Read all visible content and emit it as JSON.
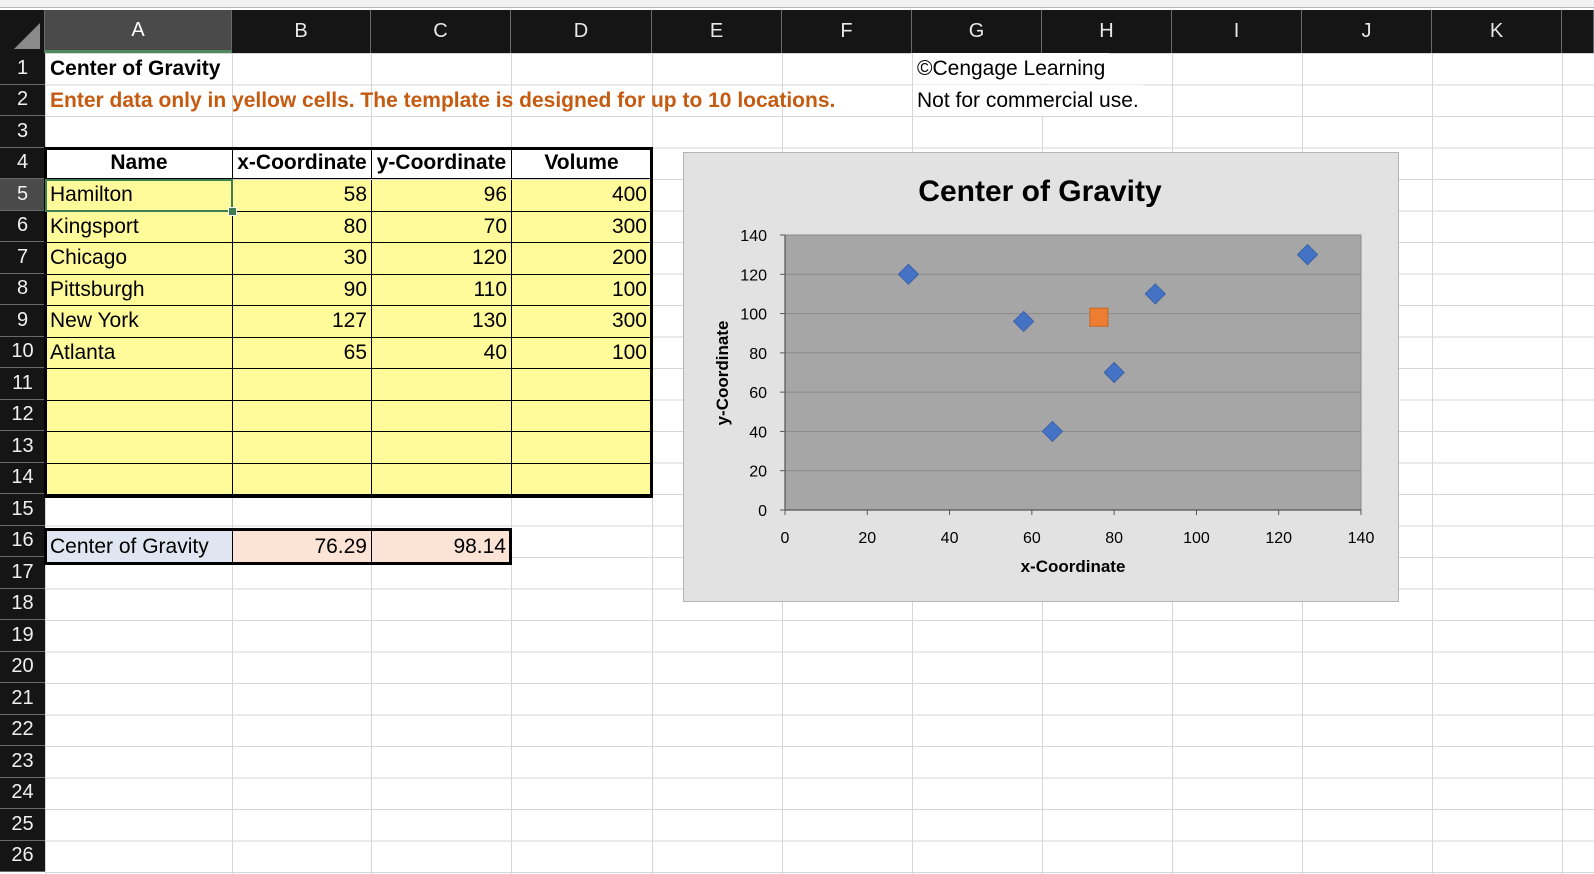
{
  "columns": [
    "A",
    "B",
    "C",
    "D",
    "E",
    "F",
    "G",
    "H",
    "I",
    "J",
    "K"
  ],
  "rows": [
    "1",
    "2",
    "3",
    "4",
    "5",
    "6",
    "7",
    "8",
    "9",
    "10",
    "11",
    "12",
    "13",
    "14",
    "15",
    "16",
    "17",
    "18",
    "19",
    "20",
    "21",
    "22",
    "23",
    "24",
    "25",
    "26"
  ],
  "title": "Center of Gravity",
  "instruction": "Enter data only in yellow cells.  The template is designed for up to 10 locations.",
  "copyright": "©Cengage Learning",
  "usage_note": "Not for commercial use.",
  "table": {
    "headers": [
      "Name",
      "x-Coordinate",
      "y-Coordinate",
      "Volume"
    ],
    "rows": [
      [
        "Hamilton",
        "58",
        "96",
        "400"
      ],
      [
        "Kingsport",
        "80",
        "70",
        "300"
      ],
      [
        "Chicago",
        "30",
        "120",
        "200"
      ],
      [
        "Pittsburgh",
        "90",
        "110",
        "100"
      ],
      [
        "New York",
        "127",
        "130",
        "300"
      ],
      [
        "Atlanta",
        "65",
        "40",
        "100"
      ],
      [
        "",
        "",
        "",
        ""
      ],
      [
        "",
        "",
        "",
        ""
      ],
      [
        "",
        "",
        "",
        ""
      ],
      [
        "",
        "",
        "",
        ""
      ]
    ]
  },
  "cog_row": {
    "label": "Center of Gravity",
    "x": "76.29",
    "y": "98.14"
  },
  "colors": {
    "yellow": "#fffb9b",
    "pink": "#fbe3d6",
    "location_marker": "#4472c4",
    "cog_marker": "#ed7d31",
    "plot_area": "#a6a6a6"
  },
  "chart_data": {
    "type": "scatter",
    "title": "Center of Gravity",
    "xlabel": "x-Coordinate",
    "ylabel": "y-Coordinate",
    "xlim": [
      0,
      140
    ],
    "ylim": [
      0,
      140
    ],
    "xticks": [
      "0",
      "20",
      "40",
      "60",
      "80",
      "100",
      "120",
      "140"
    ],
    "yticks": [
      "0",
      "20",
      "40",
      "60",
      "80",
      "100",
      "120",
      "140"
    ],
    "grid": "horizontal",
    "series": [
      {
        "marker": "diamond",
        "color": "#4472c4",
        "x": [
          58,
          80,
          30,
          90,
          127,
          65
        ],
        "y": [
          96,
          70,
          120,
          110,
          130,
          40
        ]
      },
      {
        "marker": "square",
        "color": "#ed7d31",
        "x": [
          76.29
        ],
        "y": [
          98.14
        ]
      }
    ]
  }
}
